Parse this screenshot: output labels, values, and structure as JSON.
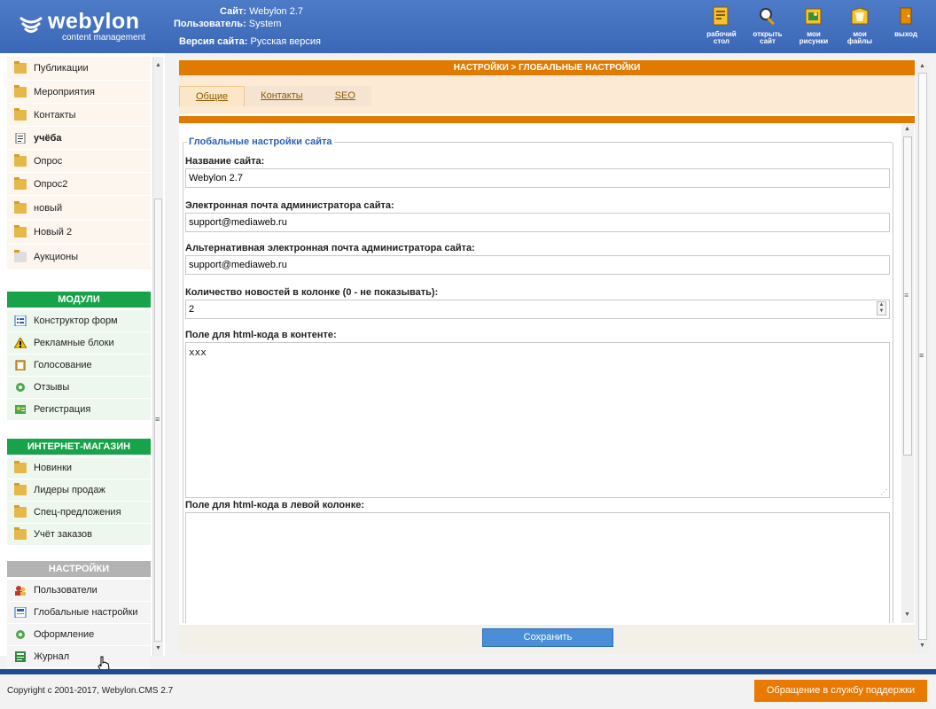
{
  "header": {
    "logo_text": "webylon",
    "logo_sub": "content management",
    "site_label": "Сайт:",
    "site_value": "Webylon 2.7",
    "user_label": "Пользователь:",
    "user_value": "System",
    "version_label": "Версия сайта:",
    "version_value": "Русская версия",
    "tools": [
      {
        "line1": "рабочий",
        "line2": "стол"
      },
      {
        "line1": "открыть",
        "line2": "сайт"
      },
      {
        "line1": "мои",
        "line2": "рисунки"
      },
      {
        "line1": "мои",
        "line2": "файлы"
      },
      {
        "line1": "выход",
        "line2": ""
      }
    ]
  },
  "sidebar": {
    "pages": [
      {
        "label": "Публикации"
      },
      {
        "label": "Мероприятия"
      },
      {
        "label": "Контакты"
      },
      {
        "label": "учёба"
      },
      {
        "label": "Опрос"
      },
      {
        "label": "Опрос2"
      },
      {
        "label": "новый"
      },
      {
        "label": "Новый 2"
      },
      {
        "label": "Аукционы"
      }
    ],
    "modules_title": "МОДУЛИ",
    "modules": [
      {
        "label": "Конструктор форм"
      },
      {
        "label": "Рекламные блоки"
      },
      {
        "label": "Голосование"
      },
      {
        "label": "Отзывы"
      },
      {
        "label": "Регистрация"
      }
    ],
    "shop_title": "ИНТЕРНЕТ-МАГАЗИН",
    "shop": [
      {
        "label": "Новинки"
      },
      {
        "label": "Лидеры продаж"
      },
      {
        "label": "Спец-предложения"
      },
      {
        "label": "Учёт заказов"
      }
    ],
    "settings_title": "НАСТРОЙКИ",
    "settings": [
      {
        "label": "Пользователи"
      },
      {
        "label": "Глобальные настройки"
      },
      {
        "label": "Оформление"
      },
      {
        "label": "Журнал"
      }
    ]
  },
  "main": {
    "title": "НАСТРОЙКИ > ГЛОБАЛЬНЫЕ НАСТРОЙКИ",
    "tabs": [
      {
        "label": "Общие"
      },
      {
        "label": "Контакты"
      },
      {
        "label": "SEO"
      }
    ],
    "fieldset_title": "Глобальные настройки сайта",
    "fields": {
      "site_name_label": "Название сайта:",
      "site_name_value": "Webylon 2.7",
      "admin_email_label": "Электронная почта администратора сайта:",
      "admin_email_value": "support@mediaweb.ru",
      "alt_email_label": "Альтернативная электронная почта администратора сайта:",
      "alt_email_value": "support@mediaweb.ru",
      "news_count_label": "Количество новостей в колонке (0 - не показывать):",
      "news_count_value": "2",
      "html_content_label": "Поле для html-кода в контенте:",
      "html_content_value": "xxx",
      "html_left_label": "Поле для html-кода в левой колонке:",
      "html_left_value": ""
    },
    "save_label": "Сохранить"
  },
  "footer": {
    "copyright": "Copyright c 2001-2017, Webylon.CMS 2.7",
    "support_label": "Обращение в службу поддержки"
  }
}
